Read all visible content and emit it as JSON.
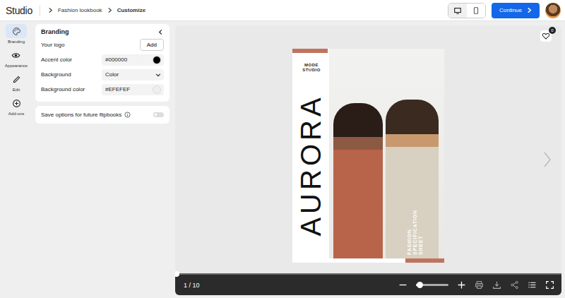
{
  "header": {
    "logo": "Studio",
    "breadcrumbs": [
      "Fashion lookbook",
      "Customize"
    ],
    "view_modes": [
      {
        "kind": "desktop",
        "selected": true
      },
      {
        "kind": "mobile",
        "selected": false
      }
    ],
    "continue_button": "Continue"
  },
  "rail": [
    {
      "label": "Branding",
      "kind": "palette",
      "selected": true
    },
    {
      "label": "Appearance",
      "kind": "eye",
      "selected": false
    },
    {
      "label": "Edit",
      "kind": "pencil",
      "selected": false
    },
    {
      "label": "Add-ons",
      "kind": "plus",
      "selected": false
    }
  ],
  "panel": {
    "title": "Branding",
    "rows": [
      {
        "label": "Your logo",
        "kind": "button",
        "value": "Add"
      },
      {
        "label": "Accent color",
        "kind": "color",
        "value": "#000000",
        "color": "#000000"
      },
      {
        "label": "Background",
        "kind": "select",
        "value": "Color"
      },
      {
        "label": "Background color",
        "kind": "color",
        "value": "#EFEFEF",
        "color": "#EFEFEF"
      }
    ]
  },
  "save_option": {
    "label": "Save options for future flipbooks",
    "on": false
  },
  "page": {
    "brand": [
      "MODE",
      "STUDIO"
    ],
    "title": "AURORA",
    "subtitle": [
      "FASHION",
      "SPECIFICATION",
      "SHEET"
    ]
  },
  "favorites": {
    "count": "0"
  },
  "toolbar": {
    "page": "1 / 10",
    "progress_level": 0.0,
    "zoom_level": 0.1
  }
}
